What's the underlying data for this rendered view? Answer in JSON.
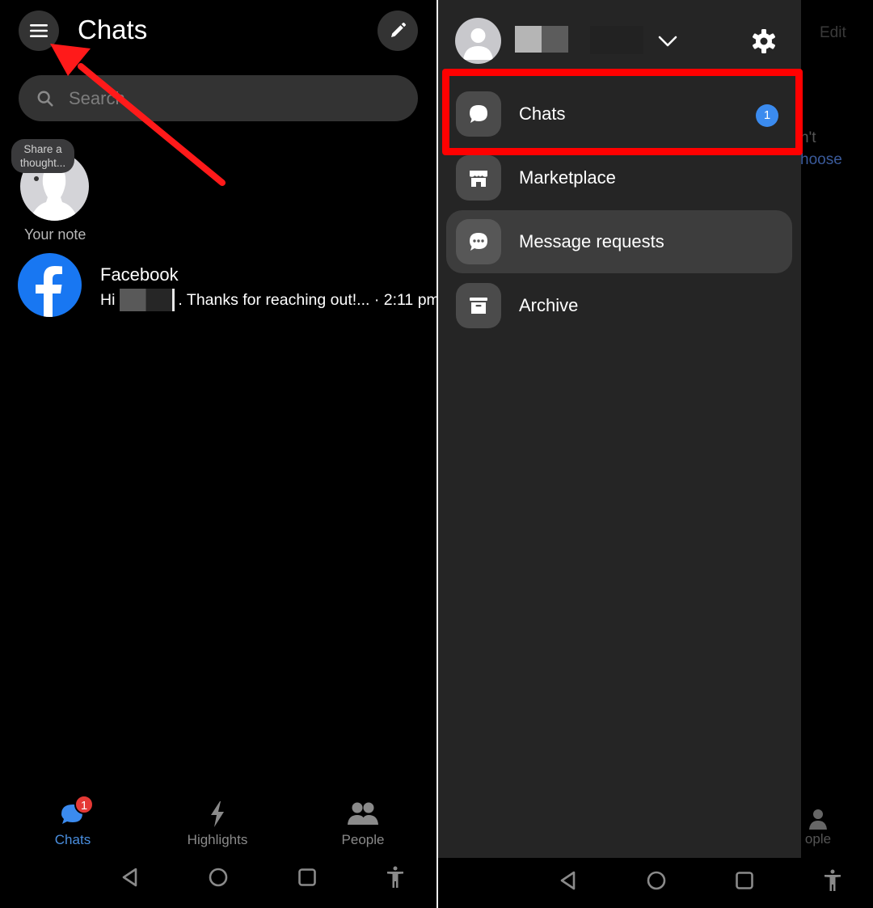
{
  "left_screen": {
    "header": {
      "title": "Chats",
      "menu_icon": "hamburger-menu-icon",
      "compose_icon": "pencil-icon"
    },
    "search": {
      "placeholder": "Search",
      "icon": "search-icon"
    },
    "note": {
      "bubble_text": "Share a thought...",
      "label": "Your note"
    },
    "conversations": [
      {
        "name": "Facebook",
        "preview_prefix": "Hi",
        "preview_suffix": ". Thanks for reaching out!... · 2:11 pm",
        "avatar": "facebook-logo-icon"
      }
    ],
    "tabbar": {
      "tabs": [
        {
          "label": "Chats",
          "icon": "chat-bubbles-icon",
          "badge": "1",
          "active": true
        },
        {
          "label": "Highlights",
          "icon": "lightning-icon",
          "active": false
        },
        {
          "label": "People",
          "icon": "people-icon",
          "active": false
        }
      ]
    }
  },
  "right_screen": {
    "background": {
      "edit_label": "Edit",
      "text_fragment_1": "n't",
      "text_fragment_2": "hoose",
      "people_label_fragment": "ople"
    },
    "drawer": {
      "profile": {
        "name_redacted": true
      },
      "items": [
        {
          "label": "Chats",
          "icon": "chat-bubble-icon",
          "badge": "1",
          "highlighted": true
        },
        {
          "label": "Marketplace",
          "icon": "storefront-icon"
        },
        {
          "label": "Message requests",
          "icon": "message-dots-icon",
          "active": true
        },
        {
          "label": "Archive",
          "icon": "archive-box-icon"
        }
      ]
    }
  },
  "system_nav": {
    "buttons": [
      "back",
      "home",
      "recents",
      "accessibility"
    ]
  },
  "colors": {
    "accent_blue": "#3b8bef",
    "facebook_blue": "#1877f2",
    "badge_red": "#e53935",
    "annotation_red": "#ff0000",
    "drawer_bg": "#252525"
  }
}
